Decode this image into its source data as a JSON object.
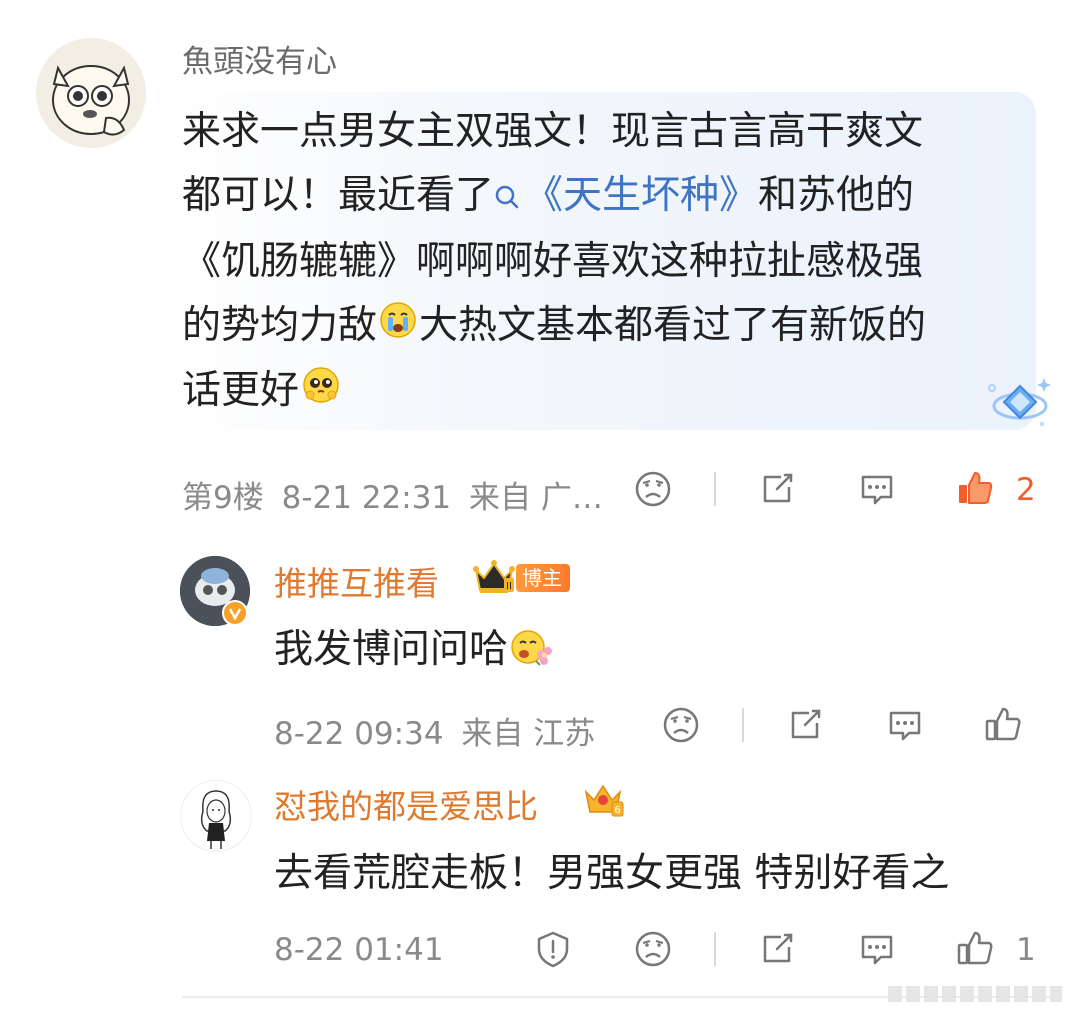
{
  "comment": {
    "username": "魚頭没有心",
    "text_lines": [
      [
        "来求一点男女主双强文！现言古言高干爽文"
      ],
      [
        "都可以！最近看了",
        "《天生坏种》",
        "和苏他的"
      ],
      [
        "《饥肠辘辘》啊啊啊好喜欢这种拉扯感极强"
      ],
      [
        "的势均力敌",
        "大热文基本都看过了有新饭的"
      ],
      [
        "话更好"
      ]
    ],
    "hashtag": "《天生坏种》",
    "floor": "第9楼",
    "time": "8-21 22:31",
    "source": "来自 广…",
    "like_count": "2"
  },
  "replies": [
    {
      "username": "推推互推看",
      "badge": "博主",
      "text": "我发博问问哈",
      "time": "8-22 09:34",
      "source": "来自 江苏",
      "like_count": ""
    },
    {
      "username": "怼我的都是爱思比",
      "text": "去看荒腔走板！男强女更强 特别好看之",
      "time": "8-22 01:41",
      "source": "",
      "like_count": "1"
    }
  ],
  "colors": {
    "accent_orange": "#e07a2f",
    "hashtag_blue": "#3f73c4",
    "like_active": "#f35c2b",
    "meta_gray": "#8a8a8a"
  }
}
